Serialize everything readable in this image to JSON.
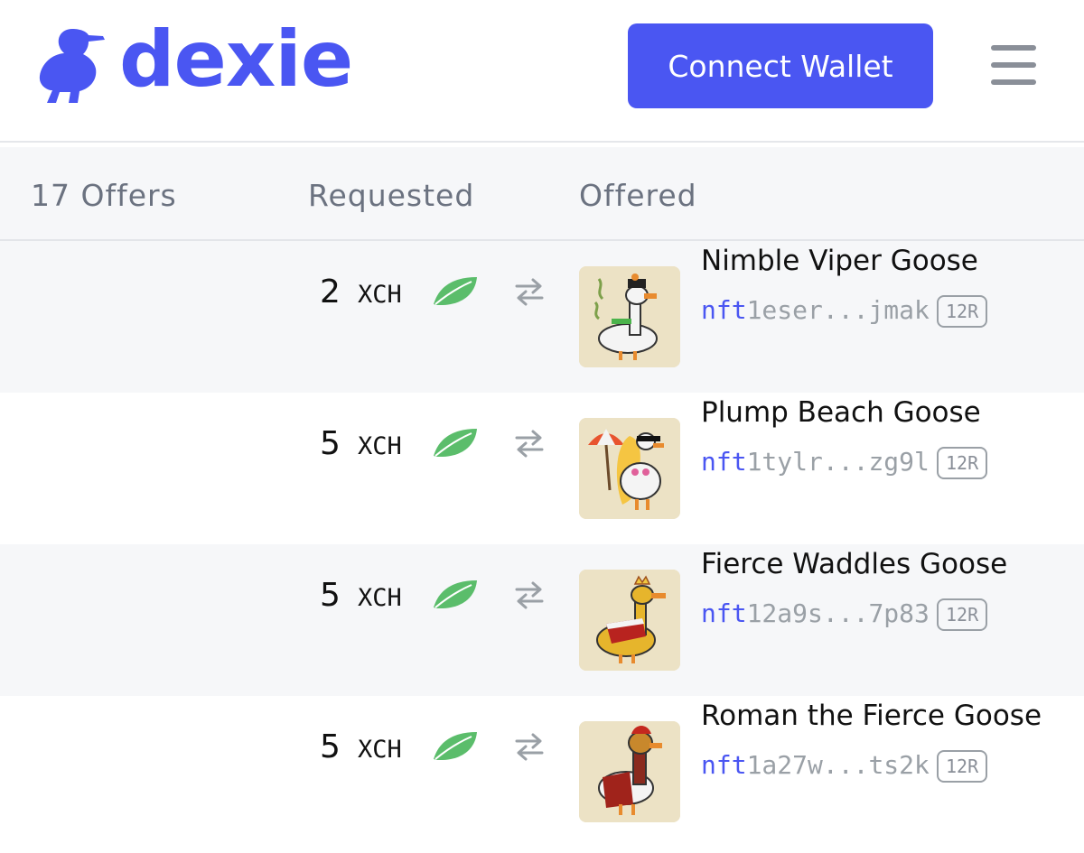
{
  "colors": {
    "brand": "#4a56f2",
    "leaf": "#5bbd6b"
  },
  "header": {
    "logo_text": "dexie",
    "logo_icon": "duck-icon",
    "connect_label": "Connect Wallet",
    "menu_icon": "hamburger-menu-icon"
  },
  "table": {
    "offers_count": "17 Offers",
    "requested_label": "Requested",
    "offered_label": "Offered"
  },
  "rows": [
    {
      "amount": "2",
      "unit": "XCH",
      "name": "Nimble Viper Goose",
      "id_prefix": "nft",
      "id_rest": "1eser...jmak",
      "badge": "12R"
    },
    {
      "amount": "5",
      "unit": "XCH",
      "name": "Plump Beach Goose",
      "id_prefix": "nft",
      "id_rest": "1tylr...zg9l",
      "badge": "12R"
    },
    {
      "amount": "5",
      "unit": "XCH",
      "name": "Fierce Waddles Goose",
      "id_prefix": "nft",
      "id_rest": "12a9s...7p83",
      "badge": "12R"
    },
    {
      "amount": "5",
      "unit": "XCH",
      "name": "Roman the Fierce Goose",
      "id_prefix": "nft",
      "id_rest": "1a27w...ts2k",
      "badge": "12R"
    }
  ]
}
